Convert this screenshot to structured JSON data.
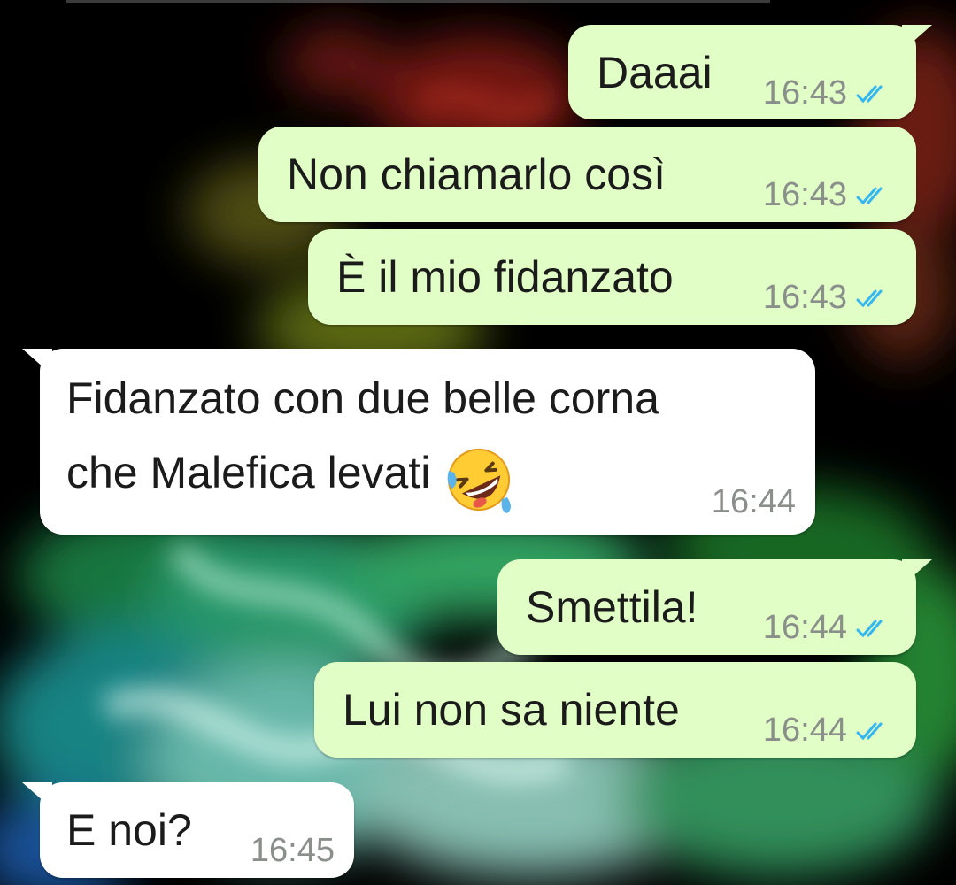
{
  "chat": {
    "background": "dark smoke (red, yellow, green, cyan) wallpaper",
    "colors": {
      "outgoing": "#e1fec6",
      "incoming": "#ffffff",
      "time": "#8a8f8b",
      "read_tick": "#34b7f1"
    },
    "messages": [
      {
        "direction": "outgoing",
        "text": "Daaai",
        "time": "16:43",
        "status_icon": "double-check-icon"
      },
      {
        "direction": "outgoing",
        "text": "Non chiamarlo così",
        "time": "16:43",
        "status_icon": "double-check-icon"
      },
      {
        "direction": "outgoing",
        "text": "È il mio fidanzato",
        "time": "16:43",
        "status_icon": "double-check-icon"
      },
      {
        "direction": "incoming",
        "text_line1": "Fidanzato con due belle corna",
        "text_line2": "che Malefica levati",
        "emoji": "rolling-on-floor-laughing-emoji",
        "time": "16:44"
      },
      {
        "direction": "outgoing",
        "text": "Smettila!",
        "time": "16:44",
        "status_icon": "double-check-icon"
      },
      {
        "direction": "outgoing",
        "text": "Lui non sa niente",
        "time": "16:44",
        "status_icon": "double-check-icon"
      },
      {
        "direction": "incoming",
        "text": "E noi?",
        "time": "16:45"
      }
    ]
  }
}
